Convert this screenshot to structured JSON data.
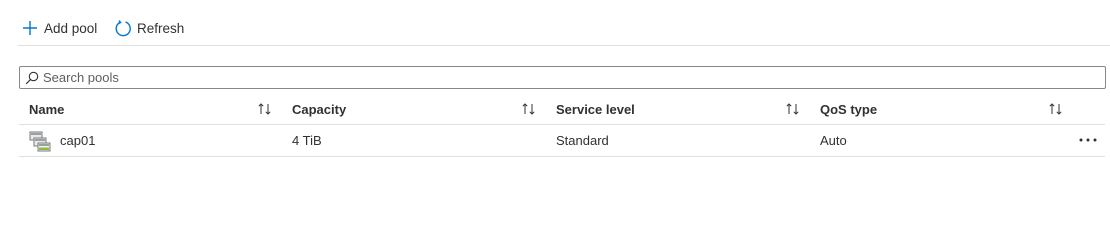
{
  "toolbar": {
    "add_label": "Add pool",
    "refresh_label": "Refresh"
  },
  "search": {
    "placeholder": "Search pools",
    "value": ""
  },
  "table": {
    "columns": [
      "Name",
      "Capacity",
      "Service level",
      "QoS type"
    ],
    "rows": [
      {
        "name": "cap01",
        "capacity": "4 TiB",
        "service_level": "Standard",
        "qos_type": "Auto"
      }
    ]
  },
  "colors": {
    "accent": "#0078d4",
    "border": "#e1dfdd"
  },
  "icons": {
    "add": "plus-icon",
    "refresh": "refresh-icon",
    "search": "search-icon",
    "sort": "sort-icon",
    "pool": "capacity-pool-icon",
    "more": "more-icon"
  }
}
